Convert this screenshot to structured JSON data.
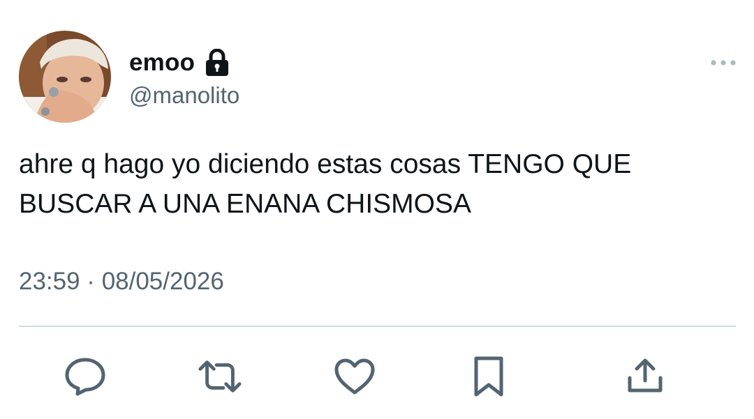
{
  "user": {
    "display_name": "emoo",
    "handle": "@manolito",
    "protected_icon": "lock-icon"
  },
  "tweet": {
    "text": "ahre q hago yo diciendo estas cosas TENGO QUE BUSCAR A UNA ENANA CHISMOSA",
    "timestamp": "23:59 · 08/05/2026"
  },
  "actions": [
    {
      "name": "reply",
      "icon": "reply-icon"
    },
    {
      "name": "retweet",
      "icon": "retweet-icon"
    },
    {
      "name": "like",
      "icon": "heart-icon"
    },
    {
      "name": "bookmark",
      "icon": "bookmark-icon"
    },
    {
      "name": "share",
      "icon": "share-icon"
    }
  ],
  "colors": {
    "text_primary": "#0f1419",
    "text_secondary": "#536471",
    "divider": "#cfd9de",
    "icon": "#536471"
  }
}
